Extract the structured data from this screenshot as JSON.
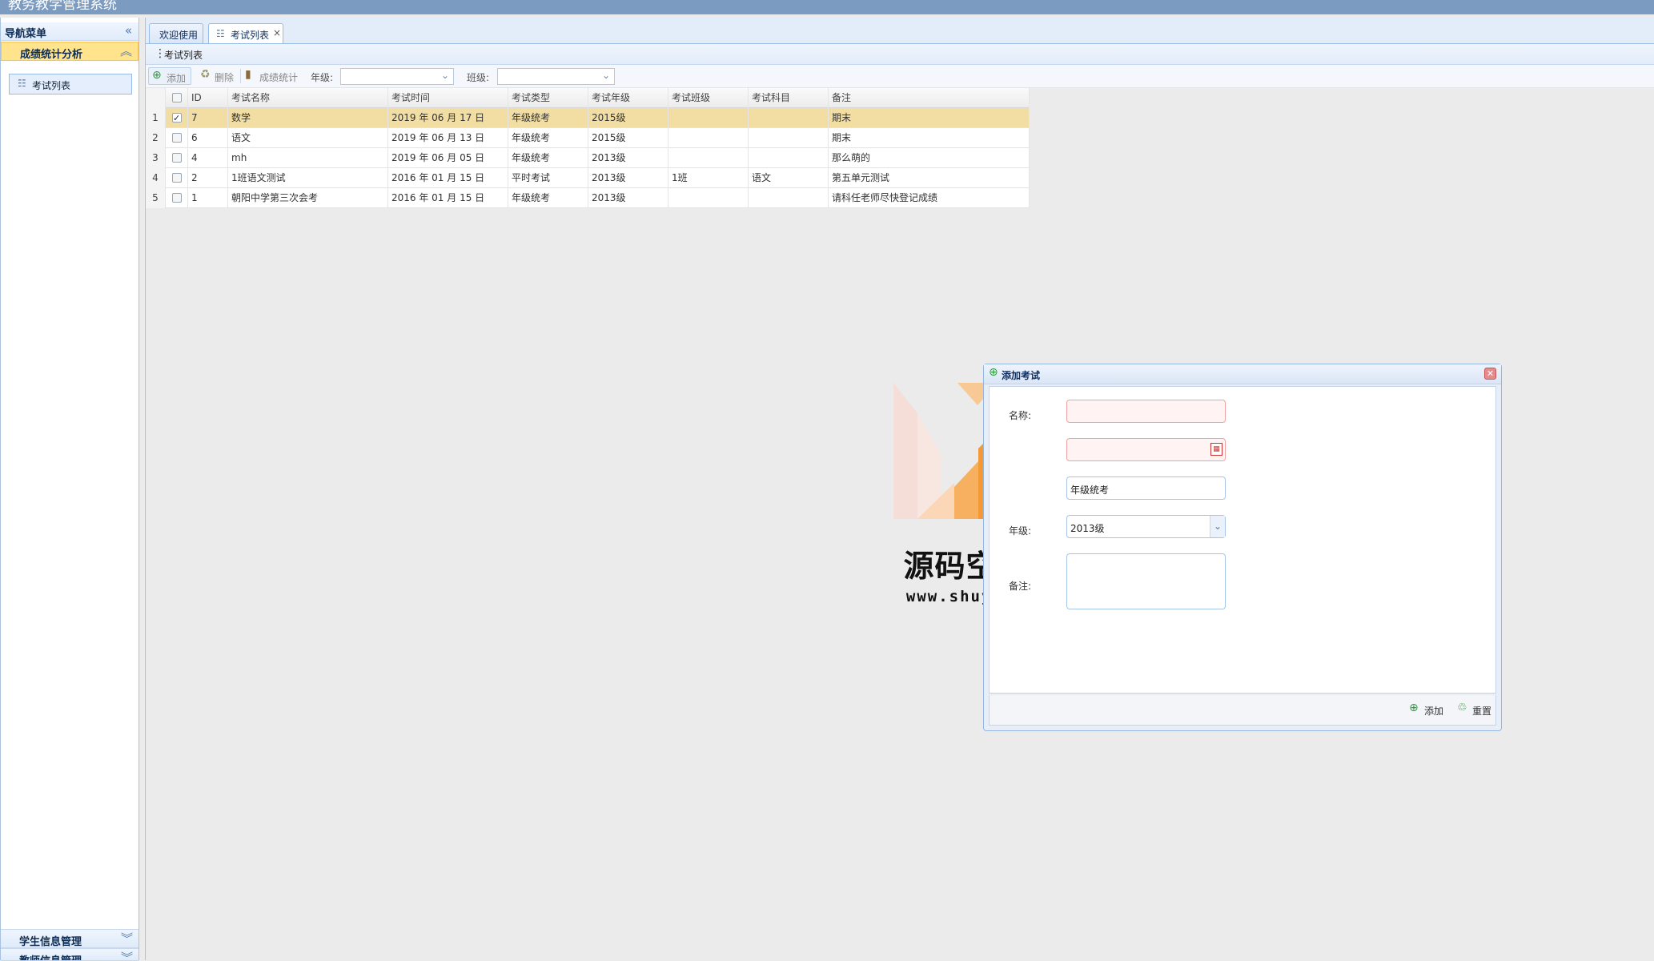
{
  "app": {
    "title": "教务教学管理系统"
  },
  "sidebar": {
    "header": "导航菜单",
    "collapse_icon": "double-chevron-left-icon",
    "sections": [
      {
        "label": "成绩统计分析",
        "expanded": true,
        "items": [
          {
            "label": "考试列表"
          }
        ]
      },
      {
        "label": "学生信息管理",
        "expanded": false
      },
      {
        "label": "教师信息管理",
        "expanded": false
      }
    ]
  },
  "tabs": [
    {
      "label": "欢迎使用",
      "active": false
    },
    {
      "label": "考试列表",
      "active": true,
      "closable": true
    }
  ],
  "panel": {
    "title": "考试列表"
  },
  "toolbar": {
    "add_label": "添加",
    "delete_label": "删除",
    "stats_label": "成绩统计",
    "grade_label": "年级:",
    "grade_value": "",
    "class_label": "班级:",
    "class_value": ""
  },
  "grid": {
    "columns": [
      "ID",
      "考试名称",
      "考试时间",
      "考试类型",
      "考试年级",
      "考试班级",
      "考试科目",
      "备注"
    ],
    "rows": [
      {
        "n": "1",
        "checked": true,
        "id": "7",
        "name": "数学",
        "time": "2019 年 06 月 17 日",
        "type": "年级统考",
        "grade": "2015级",
        "class": "",
        "subject": "",
        "note": "期末"
      },
      {
        "n": "2",
        "checked": false,
        "id": "6",
        "name": "语文",
        "time": "2019 年 06 月 13 日",
        "type": "年级统考",
        "grade": "2015级",
        "class": "",
        "subject": "",
        "note": "期末"
      },
      {
        "n": "3",
        "checked": false,
        "id": "4",
        "name": "mh",
        "time": "2019 年 06 月 05 日",
        "type": "年级统考",
        "grade": "2013级",
        "class": "",
        "subject": "",
        "note": "那么萌的"
      },
      {
        "n": "4",
        "checked": false,
        "id": "2",
        "name": "1班语文测试",
        "time": "2016 年 01 月 15 日",
        "type": "平时考试",
        "grade": "2013级",
        "class": "1班",
        "subject": "语文",
        "note": "第五单元测试"
      },
      {
        "n": "5",
        "checked": false,
        "id": "1",
        "name": "朝阳中学第三次会考",
        "time": "2016 年 01 月 15 日",
        "type": "年级统考",
        "grade": "2013级",
        "class": "",
        "subject": "",
        "note": "请科任老师尽快登记成绩"
      }
    ]
  },
  "dialog": {
    "title": "添加考试",
    "fields": {
      "name_label": "名称:",
      "name_value": "",
      "time_value": "",
      "type_value": "年级统考",
      "grade_label": "年级:",
      "grade_value": "2013级",
      "note_label": "备注:",
      "note_value": ""
    },
    "add_label": "添加",
    "reset_label": "重置"
  },
  "watermark": {
    "title": "源码空间站",
    "url": "www.shuyue.fun"
  },
  "colors": {
    "selected_row": "#f2dea3",
    "accent": "#f08c1e",
    "titlebar": "#7b9bc0"
  }
}
